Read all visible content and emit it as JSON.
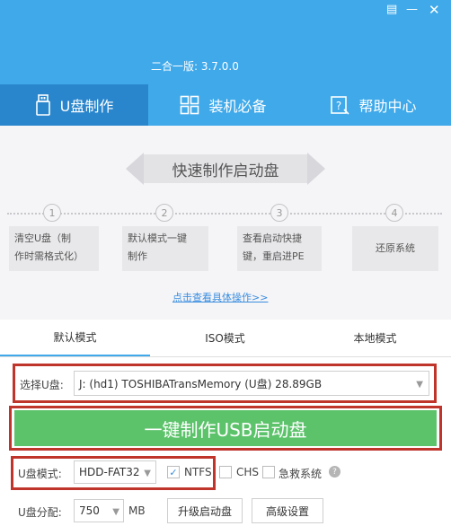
{
  "window": {
    "version": "二合一版: 3.7.0.0",
    "menu_icon": "menu-icon",
    "minimize_icon": "minimize-icon",
    "close_icon": "close-icon"
  },
  "tabs": [
    {
      "label": "U盘制作",
      "icon": "usb-drive-icon",
      "active": true
    },
    {
      "label": "装机必备",
      "icon": "grid-icon",
      "active": false
    },
    {
      "label": "帮助中心",
      "icon": "help-doc-icon",
      "active": false
    }
  ],
  "guide": {
    "title": "快速制作启动盘",
    "steps": [
      {
        "num": "1",
        "line1": "清空U盘（制",
        "line2": "作时需格式化）"
      },
      {
        "num": "2",
        "line1": "默认模式一键",
        "line2": "制作"
      },
      {
        "num": "3",
        "line1": "查看启动快捷",
        "line2": "键，重启进PE"
      },
      {
        "num": "4",
        "line1": "还原系统",
        "line2": ""
      }
    ],
    "link": "点击查看具体操作>>"
  },
  "mode_tabs": [
    {
      "label": "默认模式",
      "active": true
    },
    {
      "label": "ISO模式",
      "active": false
    },
    {
      "label": "本地模式",
      "active": false
    }
  ],
  "form": {
    "udisk_label": "选择U盘:",
    "udisk_value": "J: (hd1) TOSHIBATransMemory (U盘) 28.89GB",
    "make_button": "一键制作USB启动盘",
    "mode_label": "U盘模式:",
    "mode_value": "HDD-FAT32",
    "ntfs_label": "NTFS",
    "ntfs_checked": true,
    "chs_label": "CHS",
    "chs_checked": false,
    "rescue_label": "急救系统",
    "rescue_checked": false,
    "partition_label": "U盘分配:",
    "partition_value": "750",
    "partition_unit": "MB",
    "upgrade_button": "升级启动盘",
    "advanced_button": "高级设置"
  },
  "colors": {
    "header": "#3fa9ea",
    "active_tab": "#2a86cc",
    "make_button": "#5cc36b",
    "highlight_box": "#c0352b"
  }
}
